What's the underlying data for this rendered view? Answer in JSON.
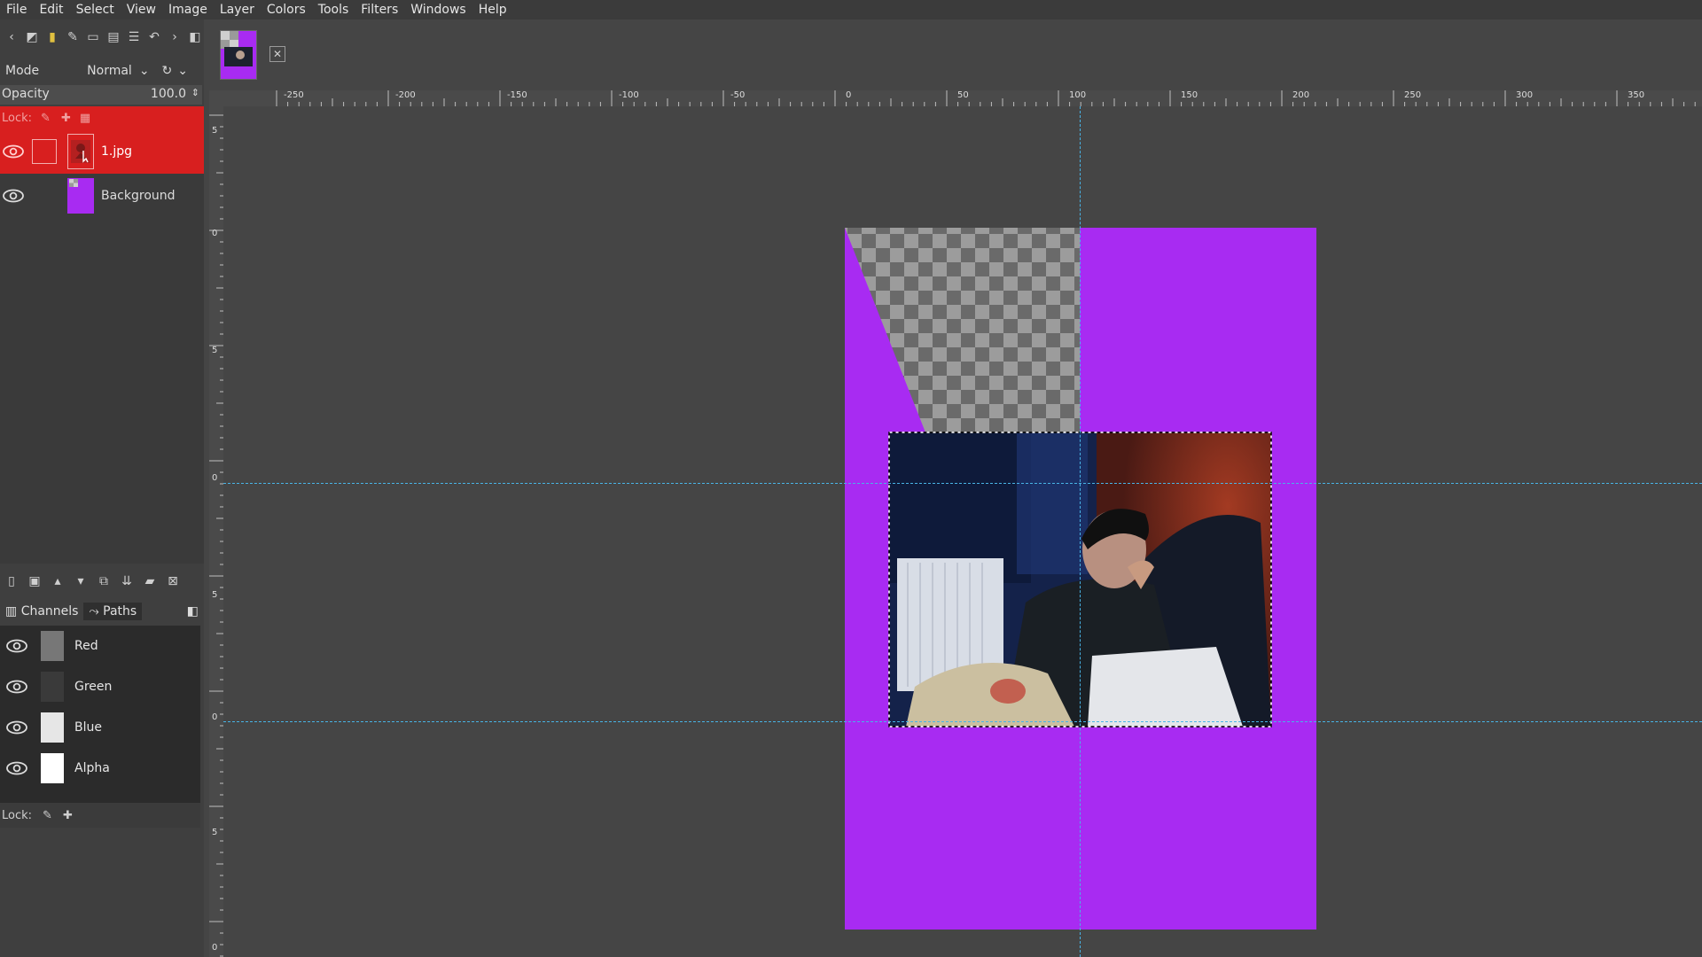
{
  "menu": [
    "File",
    "Edit",
    "Select",
    "View",
    "Image",
    "Layer",
    "Colors",
    "Tools",
    "Filters",
    "Windows",
    "Help"
  ],
  "layers_panel": {
    "mode_label": "Mode",
    "mode_value": "Normal",
    "opacity_label": "Opacity",
    "opacity_value": "100.0",
    "lock_label": "Lock:",
    "layers": [
      {
        "name": "1.jpg",
        "active": true
      },
      {
        "name": "Background",
        "active": false
      }
    ]
  },
  "channels_panel": {
    "tabs": [
      "Channels",
      "Paths"
    ],
    "channels": [
      "Red",
      "Green",
      "Blue",
      "Alpha"
    ],
    "lock_label": "Lock:"
  },
  "ruler": {
    "top_labels": [
      "-250",
      "-200",
      "-150",
      "-100",
      "-50",
      "0",
      "50",
      "100",
      "150",
      "200",
      "250",
      "300",
      "350"
    ],
    "left_labels": [
      "5",
      "0",
      "5",
      "0",
      "5",
      "0",
      "5",
      "0"
    ]
  },
  "colors": {
    "accent_active_layer": "#d81f1f",
    "background_layer_fill": "#a82bf2",
    "guide": "#48b4e6",
    "canvas_bg": "#454545"
  }
}
